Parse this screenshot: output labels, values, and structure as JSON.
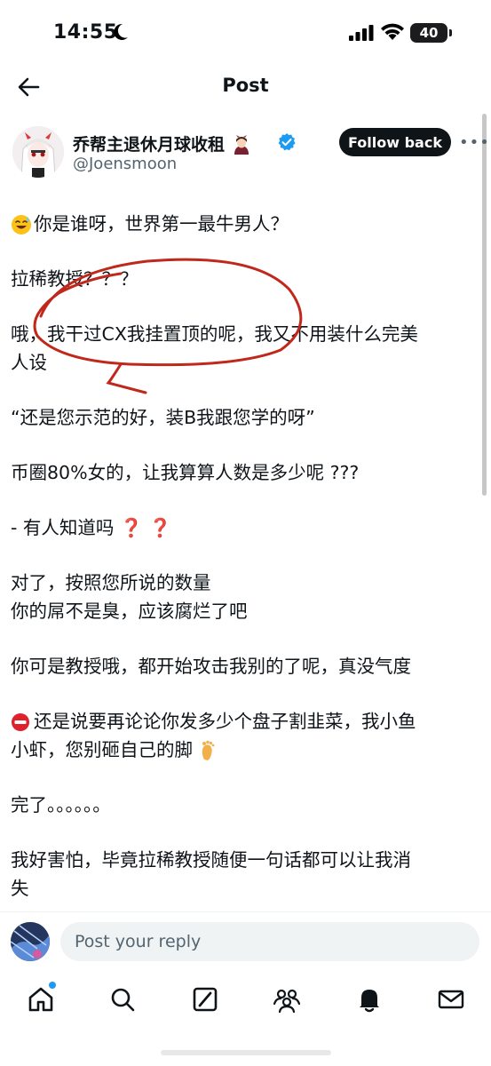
{
  "status_bar": {
    "time": "14:55",
    "battery": "40"
  },
  "header": {
    "title": "Post"
  },
  "author": {
    "name": "乔帮主退休月球收租",
    "handle": "@Joensmoon",
    "follow_label": "Follow back"
  },
  "post": {
    "line1": "你是谁呀，世界第一最牛男人？",
    "line2": "拉稀教授？？？",
    "line3a": "哦，我干过CX我挂置顶的呢，我又不用装什么完美",
    "line3b": "人设",
    "line4": "“还是您示范的好，装B我跟您学的呀”",
    "line5": "币圈80%女的，让我算算人数是多少呢 ???",
    "line6": "- 有人知道吗",
    "line6_marks": "❓ ❓",
    "line7a": "对了，按照您所说的数量",
    "line7b": "你的屌不是臭，应该腐烂了吧",
    "line8": "你可是教授哦，都开始攻击我别的了呢，真没气度",
    "line9a": "还是说要再论论你发多少个盘子割韭菜，我小鱼",
    "line9b": "小虾，您别砸自己的脚",
    "line10": "完了。。。。。。",
    "line11a": "我好害怕，毕竟拉稀教授随便一句话都可以让我消",
    "line11b": "失"
  },
  "reply": {
    "placeholder": "Post your reply"
  },
  "icons": {
    "status": [
      "moon-icon",
      "signal-icon",
      "wifi-icon",
      "battery-icon"
    ],
    "tabs": [
      "home-icon",
      "search-icon",
      "grok-icon",
      "communities-icon",
      "notifications-icon",
      "messages-icon"
    ]
  },
  "colors": {
    "accent": "#1d9bf0",
    "text": "#0f1419",
    "secondary": "#536471",
    "annotation": "#c0281b"
  }
}
